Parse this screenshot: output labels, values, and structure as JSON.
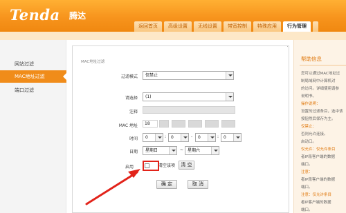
{
  "brand": {
    "logo": "Tenda",
    "logo_cn": "腾达"
  },
  "tabs": [
    {
      "label": "返回首页"
    },
    {
      "label": "高级设置"
    },
    {
      "label": "无线设置"
    },
    {
      "label": "带宽控制"
    },
    {
      "label": "特殊应用"
    },
    {
      "label": "行为管理",
      "active": true
    }
  ],
  "sidebar": {
    "items": [
      {
        "label": "网站过滤"
      },
      {
        "label": "MAC地址过滤",
        "active": true
      },
      {
        "label": "端口过滤"
      }
    ]
  },
  "panel": {
    "title": "MAC地址过滤",
    "mode_label": "过滤模式",
    "mode_value": "仅禁止",
    "select_label": "请选择",
    "select_value": "(1)",
    "note_label": "注释",
    "note_value": "",
    "mac_label": "MAC 地址",
    "mac_first": "18",
    "time_label": "时间",
    "time_values": [
      "0",
      "0",
      "0",
      "0"
    ],
    "time_colon": ":",
    "time_dash": "-",
    "date_label": "日期",
    "date_from": "星期日",
    "date_tilde": "~",
    "date_to": "星期六",
    "enable_label": "启用",
    "enable_checked": false,
    "clear_label": "清空该项",
    "clear_button": "清 空",
    "ok_button": "确 定",
    "cancel_button": "取 消"
  },
  "help": {
    "title": "帮助信息",
    "lines": [
      {
        "text": "您可以通过MAC地址过",
        "accent": false
      },
      {
        "text": "制局域网中计算机对",
        "accent": false
      },
      {
        "text": "的访问。详细使用请参",
        "accent": false
      },
      {
        "text": "说明书。",
        "accent": false
      },
      {
        "text": "操作说明：",
        "accent": true
      },
      {
        "text": "设置的过滤条目，选中该",
        "accent": false
      },
      {
        "text": "按钮然后保存为主。",
        "accent": false
      },
      {
        "text": "仅禁止：",
        "accent": true
      },
      {
        "text": "否则允许连接。",
        "accent": false
      },
      {
        "text": "启动口。",
        "accent": false
      },
      {
        "text": "仅允许：仅允许条目",
        "accent": true
      },
      {
        "text": "者IP段客户端的数据",
        "accent": false
      },
      {
        "text": "端口。",
        "accent": false
      },
      {
        "text": "注意：",
        "accent": true
      },
      {
        "text": "者IP段客户端的数据",
        "accent": false
      },
      {
        "text": "端口。",
        "accent": false
      },
      {
        "text": "注意：仅允许条目",
        "accent": true
      },
      {
        "text": "者IP客户端的数据",
        "accent": false
      },
      {
        "text": "端口。",
        "accent": false
      }
    ]
  },
  "colors": {
    "header_orange": "#f7941d",
    "active_orange": "#f08c1a",
    "highlight_red": "#e2231a"
  }
}
